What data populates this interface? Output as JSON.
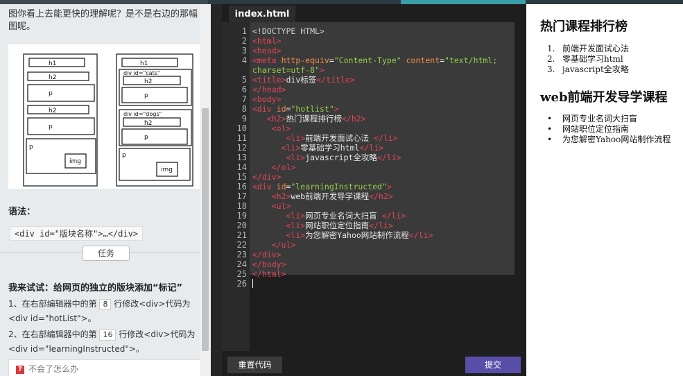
{
  "lesson": {
    "intro_text": "图你看上去能更快的理解呢？是不是右边的那幅图呢。",
    "syntax_label": "语法：",
    "syntax_code": "<div id=\"版块名称\">…</div>",
    "task_button": "任务",
    "task_heading": "我来试试：给网页的独立的版块添加“标记”",
    "steps": [
      {
        "pre": "1、在右部编辑器中的第",
        "num": "8",
        "post": "行修改<div>代码为<div id=\"hotList\">。"
      },
      {
        "pre": "2、在右部编辑器中的第",
        "num": "16",
        "post": "行修改<div>代码为<div id=\"learningInstructed\">。"
      }
    ],
    "help_text": "不会了怎么办",
    "illustration_labels": {
      "left": [
        "h1",
        "h2",
        "p",
        "h2",
        "p",
        "p",
        "img"
      ],
      "right_div1": "div id=\"cats\"",
      "right_div2": "div id=\"dogs\"",
      "right": [
        "h1",
        "h2",
        "p",
        "h2",
        "p",
        "p",
        "img"
      ]
    }
  },
  "editor": {
    "tab_label": "index.html",
    "line_numbers": [
      "1",
      "2",
      "3",
      "4",
      "",
      "5",
      "6",
      "7",
      "8",
      "9",
      "10",
      "11",
      "12",
      "13",
      "14",
      "15",
      "16",
      "17",
      "18",
      "19",
      "20",
      "21",
      "22",
      "23",
      "24",
      "25",
      "26"
    ],
    "reset_label": "重置代码",
    "submit_label": "提交"
  },
  "preview": {
    "heading1": "热门课程排行榜",
    "list1": [
      "前端开发面试心法",
      "零基础学习html",
      "javascript全攻略"
    ],
    "heading2": "web前端开发导学课程",
    "list2": [
      "网页专业名词大扫盲",
      "网站职位定位指南",
      "为您解密Yahoo网站制作流程"
    ]
  },
  "colors": {
    "accent": "#594ea8",
    "tag": "#e54558",
    "attr": "#f28c47",
    "string": "#95d04a"
  }
}
